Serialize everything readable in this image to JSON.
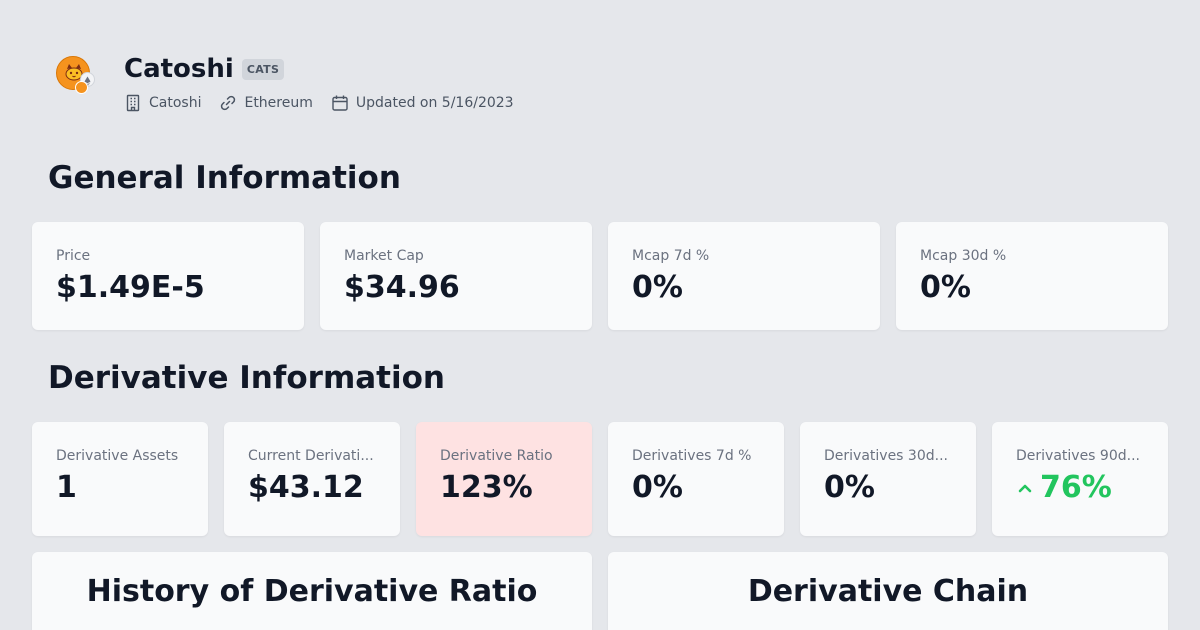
{
  "token": {
    "name": "Catoshi",
    "symbol": "CATS",
    "issuer": "Catoshi",
    "chain": "Ethereum",
    "updated": "Updated on 5/16/2023",
    "logo_icon": "cat-coin-icon",
    "chain_icon": "ethereum-icon"
  },
  "general": {
    "title": "General Information",
    "cards": [
      {
        "label": "Price",
        "value": "$1.49E-5"
      },
      {
        "label": "Market Cap",
        "value": "$34.96"
      },
      {
        "label": "Mcap 7d %",
        "value": "0%"
      },
      {
        "label": "Mcap 30d %",
        "value": "0%"
      }
    ]
  },
  "derivative": {
    "title": "Derivative Information",
    "cards": [
      {
        "label": "Derivative Assets",
        "value": "1"
      },
      {
        "label": "Current Derivati...",
        "value": "$43.12"
      },
      {
        "label": "Derivative Ratio",
        "value": "123%"
      },
      {
        "label": "Derivatives 7d %",
        "value": "0%"
      },
      {
        "label": "Derivatives 30d...",
        "value": "0%"
      },
      {
        "label": "Derivatives 90d...",
        "value": "76%"
      }
    ]
  },
  "panels": {
    "history_title": "History of Derivative Ratio",
    "chain_title": "Derivative Chain"
  },
  "colors": {
    "background": "#e5e7eb",
    "card": "#f9fafb",
    "alert_card": "#fee2e2",
    "positive": "#22c55e",
    "accent": "#f5931e"
  }
}
